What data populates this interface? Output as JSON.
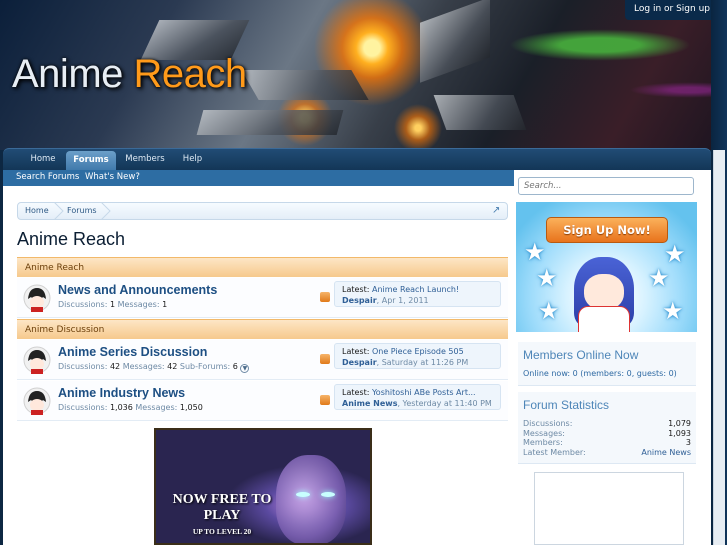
{
  "site": {
    "logo_word1": "Anime",
    "logo_word2": "Reach",
    "login_link": "Log in or Sign up"
  },
  "nav": {
    "tabs": [
      {
        "label": "Home",
        "active": false
      },
      {
        "label": "Forums",
        "active": true
      },
      {
        "label": "Members",
        "active": false
      },
      {
        "label": "Help",
        "active": false
      }
    ],
    "sub_links": [
      "Search Forums",
      "What's New?"
    ]
  },
  "breadcrumb": [
    "Home",
    "Forums"
  ],
  "page_title": "Anime Reach",
  "categories": [
    {
      "title": "Anime Reach",
      "forums": [
        {
          "title": "News and Announcements",
          "discussions_label": "Discussions:",
          "discussions": "1",
          "messages_label": "Messages:",
          "messages": "1",
          "latest_label": "Latest:",
          "latest_thread": "Anime Reach Launch!",
          "latest_user": "Despair",
          "latest_date": ", Apr 1, 2011"
        }
      ]
    },
    {
      "title": "Anime Discussion",
      "forums": [
        {
          "title": "Anime Series Discussion",
          "discussions_label": "Discussions:",
          "discussions": "42",
          "messages_label": "Messages:",
          "messages": "42",
          "subforums_label": "Sub-Forums:",
          "subforums": "6",
          "latest_label": "Latest:",
          "latest_thread": "One Piece Episode 505",
          "latest_user": "Despair",
          "latest_date": ", Saturday at 11:26 PM"
        },
        {
          "title": "Anime Industry News",
          "discussions_label": "Discussions:",
          "discussions": "1,036",
          "messages_label": "Messages:",
          "messages": "1,050",
          "latest_label": "Latest:",
          "latest_thread": "Yoshitoshi ABe Posts Art...",
          "latest_user": "Anime News",
          "latest_date": ", Yesterday at 11:40 PM"
        }
      ]
    }
  ],
  "ad": {
    "headline": "NOW FREE TO PLAY",
    "subline": "UP TO LEVEL 20"
  },
  "sidebar": {
    "search_placeholder": "Search...",
    "signup_button": "Sign Up Now!",
    "members_online": {
      "heading": "Members Online Now",
      "line": "Online now: 0 (members: 0, guests: 0)"
    },
    "forum_statistics": {
      "heading": "Forum Statistics",
      "rows": [
        {
          "label": "Discussions:",
          "value": "1,079"
        },
        {
          "label": "Messages:",
          "value": "1,093"
        },
        {
          "label": "Members:",
          "value": "3"
        },
        {
          "label": "Latest Member:",
          "value": "Anime News"
        }
      ]
    }
  },
  "colors": {
    "nav_bg": "#133657",
    "accent_link": "#1d4f83",
    "category_header": "#f6c98c",
    "signup_orange": "#e8731c"
  }
}
